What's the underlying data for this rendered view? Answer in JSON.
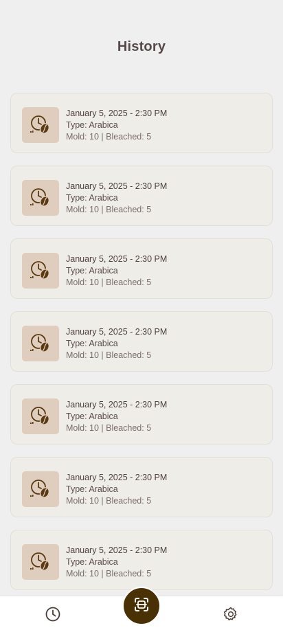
{
  "header": {
    "title": "History"
  },
  "history": {
    "items": [
      {
        "date": "January 5, 2025 - 2:30 PM",
        "type": "Type: Arabica",
        "stats": "Mold: 10 | Bleached: 5",
        "icon": "clock-coffee-bean-icon"
      },
      {
        "date": "January 5, 2025 - 2:30 PM",
        "type": "Type: Arabica",
        "stats": "Mold: 10 | Bleached: 5",
        "icon": "clock-coffee-bean-icon"
      },
      {
        "date": "January 5, 2025 - 2:30 PM",
        "type": "Type: Arabica",
        "stats": "Mold: 10 | Bleached: 5",
        "icon": "clock-coffee-bean-icon"
      },
      {
        "date": "January 5, 2025 - 2:30 PM",
        "type": "Type: Arabica",
        "stats": "Mold: 10 | Bleached: 5",
        "icon": "clock-coffee-bean-icon"
      },
      {
        "date": "January 5, 2025 - 2:30 PM",
        "type": "Type: Arabica",
        "stats": "Mold: 10 | Bleached: 5",
        "icon": "clock-coffee-bean-icon"
      },
      {
        "date": "January 5, 2025 - 2:30 PM",
        "type": "Type: Arabica",
        "stats": "Mold: 10 | Bleached: 5",
        "icon": "clock-coffee-bean-icon"
      },
      {
        "date": "January 5, 2025 - 2:30 PM",
        "type": "Type: Arabica",
        "stats": "Mold: 10 | Bleached: 5",
        "icon": "clock-coffee-bean-icon"
      }
    ]
  },
  "bottom_nav": {
    "history_icon": "clock-icon",
    "scan_icon": "scan-icon",
    "settings_icon": "gear-icon"
  },
  "colors": {
    "background": "#f0efef",
    "card": "#efede8",
    "thumb": "#dfcdbd",
    "accent": "#4a3105",
    "icon_brown": "#5a3a12"
  }
}
